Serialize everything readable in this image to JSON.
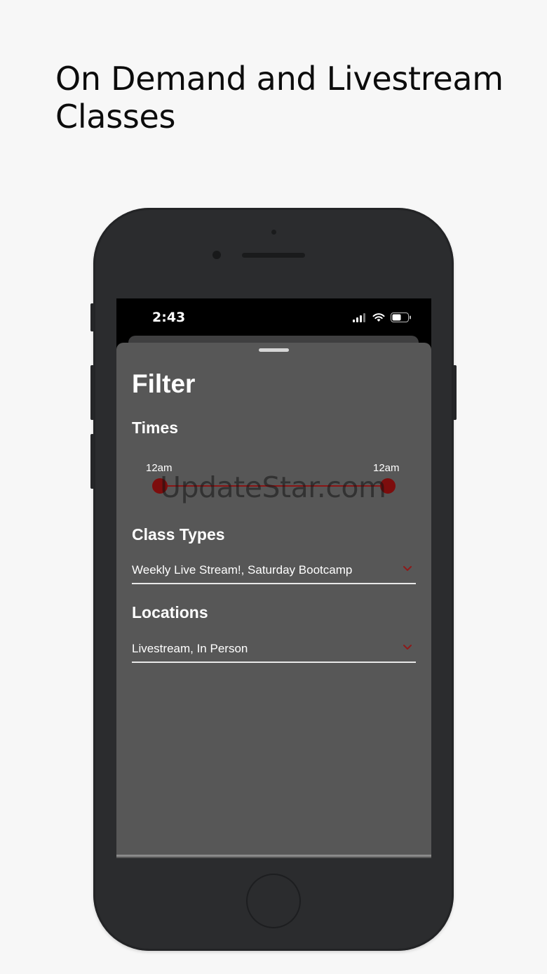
{
  "headline": "On Demand and Livestream Classes",
  "status_bar": {
    "time": "2:43"
  },
  "filter": {
    "title": "Filter",
    "times": {
      "label": "Times",
      "start_label": "12am",
      "end_label": "12am"
    },
    "class_types": {
      "label": "Class Types",
      "value": "Weekly Live Stream!, Saturday Bootcamp"
    },
    "locations": {
      "label": "Locations",
      "value": "Livestream, In Person"
    }
  },
  "watermark": "UpdateStar.com",
  "colors": {
    "accent": "#7d0d0d",
    "sheet": "#575757",
    "phone_body": "#2b2c2e"
  },
  "icons": [
    "cellular-signal-icon",
    "wifi-icon",
    "battery-icon",
    "chevron-down-icon"
  ]
}
